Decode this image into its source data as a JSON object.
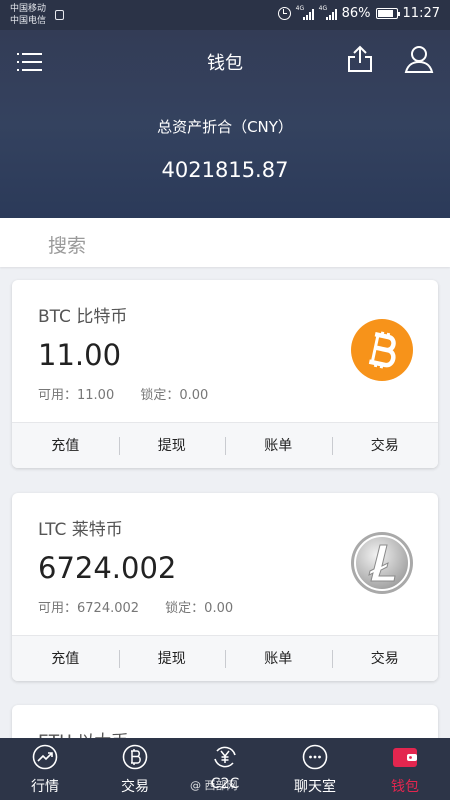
{
  "status_bar": {
    "carrier_1": "中国移动",
    "carrier_2": "中国电信",
    "battery": "86%",
    "time": "11:27",
    "network_labels": [
      "4G",
      "4G"
    ]
  },
  "header": {
    "title": "钱包",
    "total_label": "总资产折合（CNY）",
    "total_value": "4021815.87",
    "icons": [
      "menu-icon",
      "share-icon",
      "user-icon"
    ]
  },
  "search": {
    "placeholder": "搜索"
  },
  "wallets": [
    {
      "name": "BTC 比特币",
      "amount": "11.00",
      "available": "可用：11.00",
      "locked": "锁定：0.00",
      "coin_icon": "bitcoin-icon",
      "coin_color": "#f7931a",
      "actions": [
        "充值",
        "提现",
        "账单",
        "交易"
      ]
    },
    {
      "name": "LTC 莱特币",
      "amount": "6724.002",
      "available": "可用：6724.002",
      "locked": "锁定：0.00",
      "coin_icon": "litecoin-icon",
      "coin_color": "#b5b5b5",
      "actions": [
        "充值",
        "提现",
        "账单",
        "交易"
      ]
    },
    {
      "name": "ETH 以太币"
    }
  ],
  "tabbar": {
    "tabs": [
      {
        "label": "行情",
        "icon": "trend-icon"
      },
      {
        "label": "交易",
        "icon": "bitcoin-circle-icon"
      },
      {
        "label": "C2C",
        "icon": "yuan-exchange-icon"
      },
      {
        "label": "聊天室",
        "icon": "chat-icon"
      },
      {
        "label": "钱包",
        "icon": "wallet-icon",
        "active": true
      }
    ],
    "active_color": "#e3264f"
  },
  "watermark": "@ 西部网"
}
